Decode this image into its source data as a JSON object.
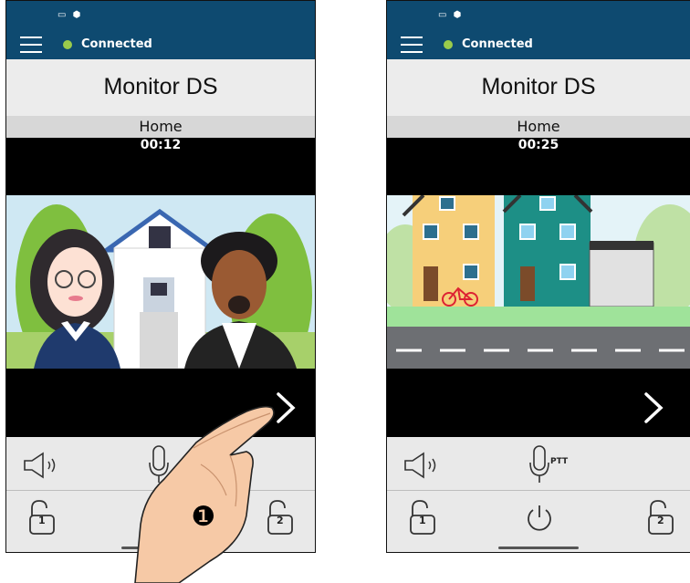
{
  "screens": [
    {
      "status": "Connected",
      "title": "Monitor DS",
      "subtitle": "Home",
      "timer": "00:12",
      "scene": "visitors-at-door",
      "unlock_1": "1",
      "unlock_2": "2"
    },
    {
      "status": "Connected",
      "title": "Monitor DS",
      "subtitle": "Home",
      "timer": "00:25",
      "scene": "street-view",
      "ptt_label": "PTT",
      "unlock_1": "1",
      "unlock_2": "2"
    }
  ],
  "annotation": {
    "step_number": "❶",
    "gesture": "swipe-right"
  },
  "colors": {
    "status_bar": "#0e4a70",
    "connected_dot": "#9bcb4b",
    "title_bar": "#ececec",
    "subtitle_bar": "#d7d7d7"
  },
  "icons": [
    "menu-icon",
    "camera-icon",
    "speaker-icon",
    "microphone-icon",
    "unlock-icon",
    "power-icon",
    "chevron-right-icon"
  ]
}
